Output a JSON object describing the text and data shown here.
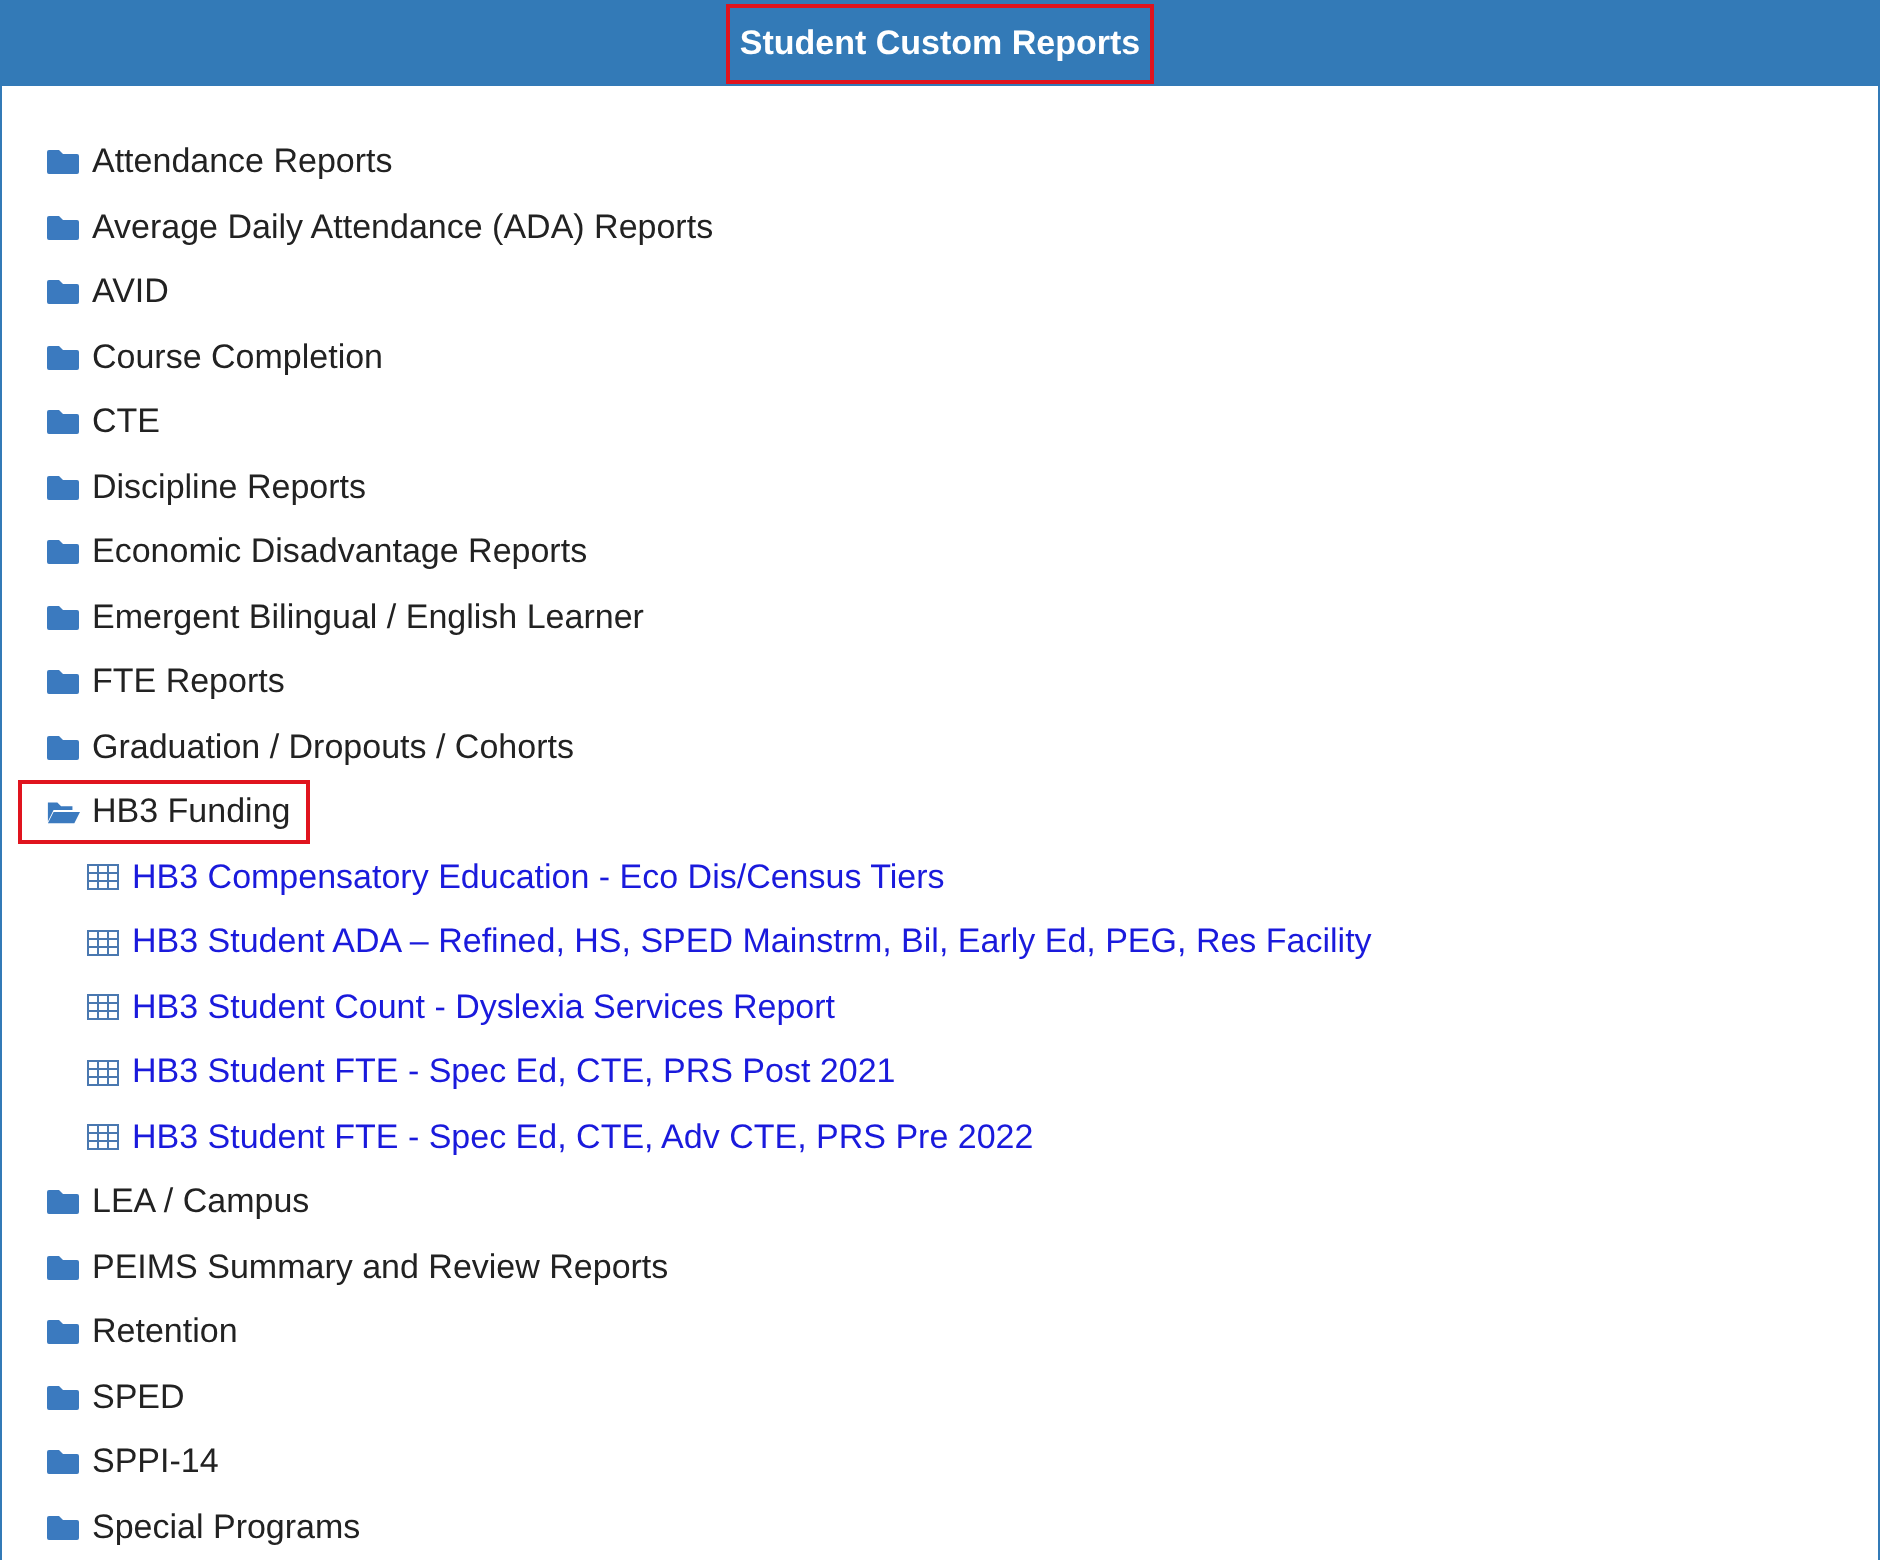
{
  "header": {
    "title": "Student Custom Reports",
    "highlighted": true
  },
  "folders": [
    {
      "label": "Attendance Reports",
      "expanded": false,
      "highlighted": false
    },
    {
      "label": "Average Daily Attendance (ADA) Reports",
      "expanded": false,
      "highlighted": false
    },
    {
      "label": "AVID",
      "expanded": false,
      "highlighted": false
    },
    {
      "label": "Course Completion",
      "expanded": false,
      "highlighted": false
    },
    {
      "label": "CTE",
      "expanded": false,
      "highlighted": false
    },
    {
      "label": "Discipline Reports",
      "expanded": false,
      "highlighted": false
    },
    {
      "label": "Economic Disadvantage Reports",
      "expanded": false,
      "highlighted": false
    },
    {
      "label": "Emergent Bilingual / English Learner",
      "expanded": false,
      "highlighted": false
    },
    {
      "label": "FTE Reports",
      "expanded": false,
      "highlighted": false
    },
    {
      "label": "Graduation / Dropouts / Cohorts",
      "expanded": false,
      "highlighted": false
    },
    {
      "label": "HB3 Funding",
      "expanded": true,
      "highlighted": true,
      "children": [
        {
          "label": "HB3 Compensatory Education - Eco Dis/Census Tiers"
        },
        {
          "label": "HB3 Student ADA – Refined, HS, SPED Mainstrm, Bil, Early Ed, PEG, Res Facility"
        },
        {
          "label": "HB3 Student Count - Dyslexia Services Report"
        },
        {
          "label": "HB3 Student FTE - Spec Ed, CTE, PRS Post 2021"
        },
        {
          "label": "HB3 Student FTE - Spec Ed, CTE, Adv CTE, PRS Pre 2022"
        }
      ]
    },
    {
      "label": "LEA / Campus",
      "expanded": false,
      "highlighted": false
    },
    {
      "label": "PEIMS Summary and Review Reports",
      "expanded": false,
      "highlighted": false
    },
    {
      "label": "Retention",
      "expanded": false,
      "highlighted": false
    },
    {
      "label": "SPED",
      "expanded": false,
      "highlighted": false
    },
    {
      "label": "SPPI-14",
      "expanded": false,
      "highlighted": false
    },
    {
      "label": "Special Programs",
      "expanded": false,
      "highlighted": false
    }
  ]
}
